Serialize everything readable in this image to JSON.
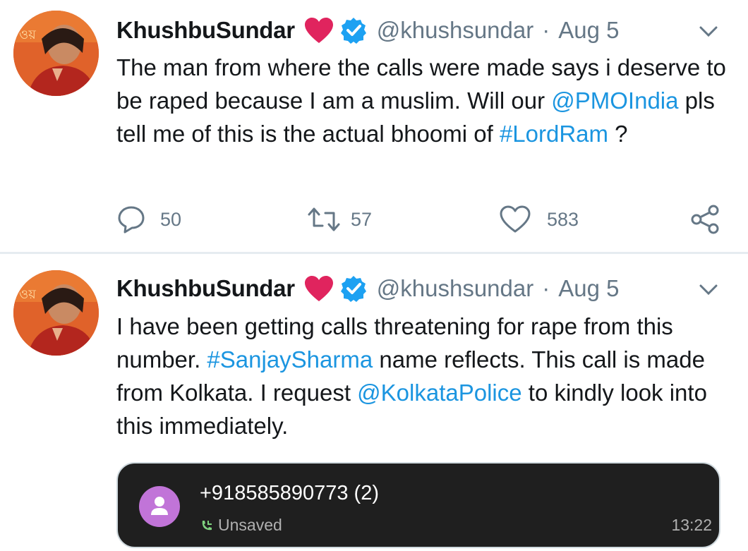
{
  "colors": {
    "link": "#1b95e0",
    "muted": "#657786",
    "heart": "#e0245e",
    "verified": "#1da1f2",
    "card_bg": "#1f1f1f",
    "contact_avatar": "#c174d8"
  },
  "tweets": [
    {
      "name": "KhushbuSundar",
      "handle": "@khushsundar",
      "sep": "·",
      "date": "Aug 5",
      "text": [
        {
          "t": "The man from where the calls were made says i deserve to be raped because I am a muslim. Will our ",
          "link": false
        },
        {
          "t": "@PMOIndia",
          "link": true
        },
        {
          "t": " pls tell me of this is the actual bhoomi of ",
          "link": false
        },
        {
          "t": "#LordRam",
          "link": true
        },
        {
          "t": " ?",
          "link": false
        }
      ],
      "actions": {
        "replies": "50",
        "retweets": "57",
        "likes": "583"
      }
    },
    {
      "name": "KhushbuSundar",
      "handle": "@khushsundar",
      "sep": "·",
      "date": "Aug 5",
      "text": [
        {
          "t": "I have been getting calls threatening for rape from this number. ",
          "link": false
        },
        {
          "t": "#SanjaySharma",
          "link": true
        },
        {
          "t": " name reflects. This call is made from Kolkata. I request ",
          "link": false
        },
        {
          "t": "@KolkataPolice",
          "link": true
        },
        {
          "t": " to kindly look into this immediately.",
          "link": false
        }
      ],
      "media": {
        "number": "+918585890773 (2)",
        "status": "Unsaved",
        "time": "13:22",
        "icons": [
          "contact-avatar-icon",
          "incoming-call-icon"
        ]
      }
    }
  ],
  "icons": [
    "avatar-photo",
    "heart-icon",
    "verified-badge-icon",
    "chevron-down-icon",
    "reply-icon",
    "retweet-icon",
    "like-icon",
    "share-icon"
  ]
}
